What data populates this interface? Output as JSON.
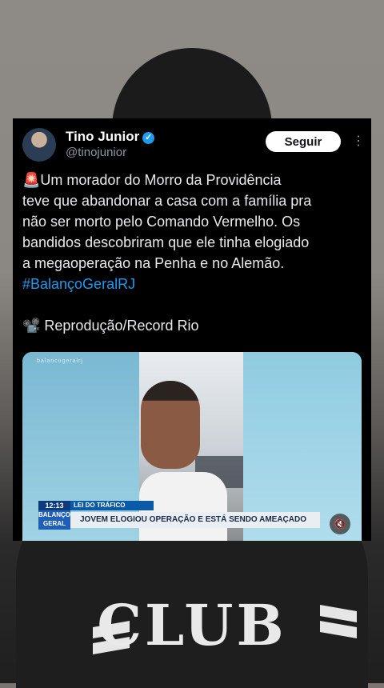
{
  "tweet": {
    "author_name": "Tino Junior",
    "author_handle": "@tinojunior",
    "follow_label": "Seguir",
    "more_icon": "⋮",
    "text_line1": "🚨Um morador do Morro da Providência",
    "text_line2": "teve que abandonar a casa com a família pra",
    "text_line3": "não ser morto pelo Comando Vermelho. Os",
    "text_line4": "bandidos descobriram que ele tinha elogiado",
    "text_line5": "a megaoperação na Penha e no Alemão.",
    "hashtag": "#BalançoGeralRJ",
    "credit": "📽️ Reprodução/Record Rio"
  },
  "media": {
    "watermark": "balancogeralrj",
    "time": "12:13",
    "topic": "LEI DO TRÁFICO",
    "logo_line1": "BALANÇO",
    "logo_line2": "GERAL",
    "headline": "JOVEM ELOGIOU OPERAÇÃO E ESTÁ SENDO AMEAÇADO",
    "mute_icon": "🔇"
  },
  "background": {
    "shirt_text": "CLUB"
  }
}
